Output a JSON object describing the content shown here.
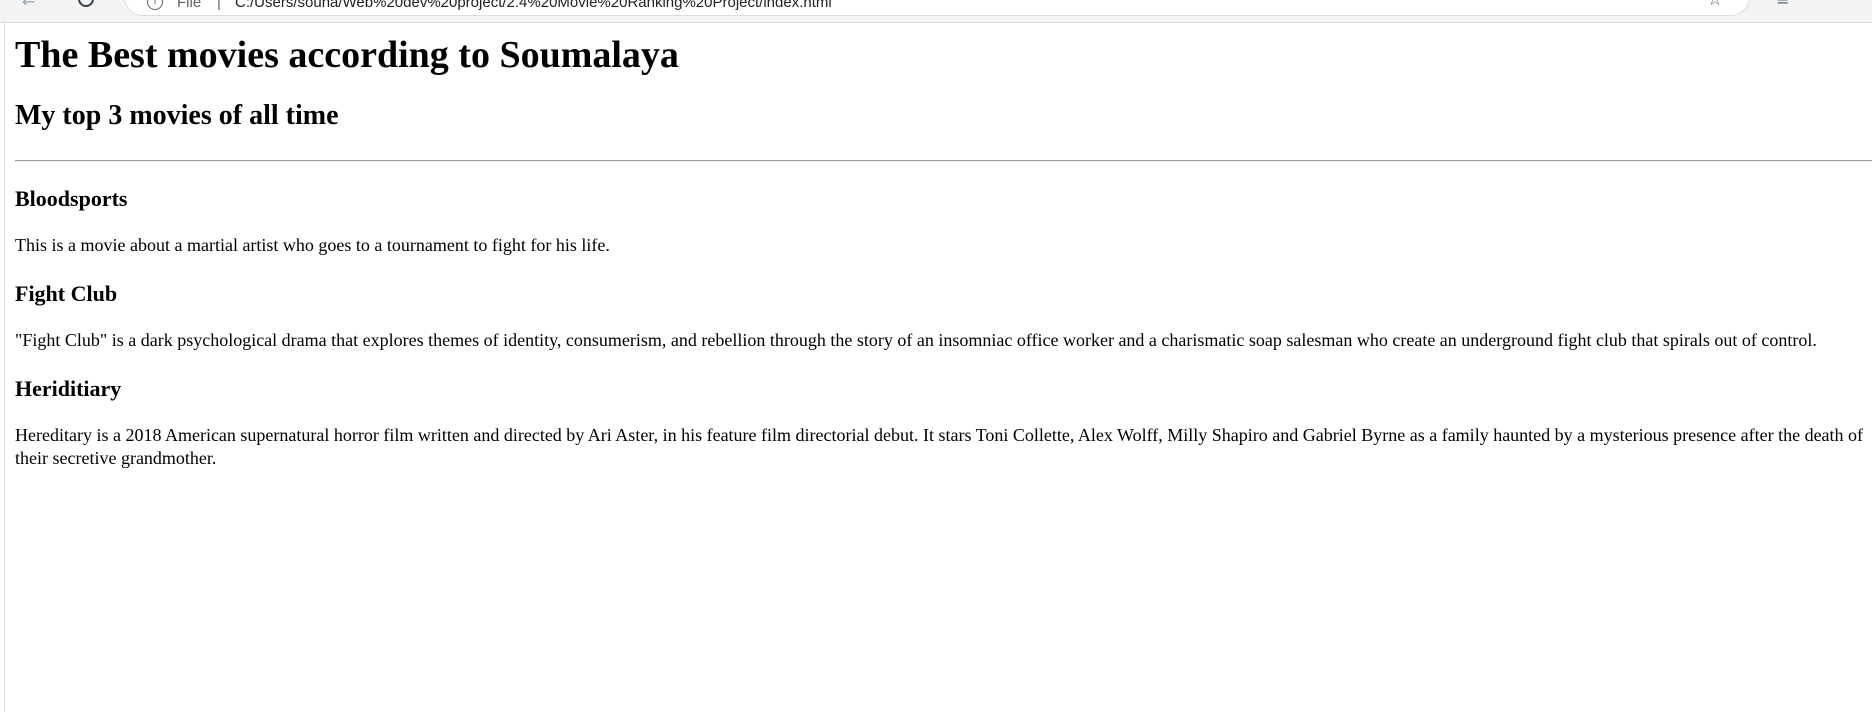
{
  "browser": {
    "scheme_label": "File",
    "url": "C:/Users/souna/Web%20dev%20project/2.4%20Movie%20Ranking%20Project/index.html"
  },
  "page": {
    "title": "The Best movies according to Soumalaya",
    "subtitle": "My top 3 movies of all time",
    "movies": [
      {
        "title": "Bloodsports",
        "description": "This is a movie about a martial artist who goes to a tournament to fight for his life."
      },
      {
        "title": "Fight Club",
        "description": "\"Fight Club\" is a dark psychological drama that explores themes of identity, consumerism, and rebellion through the story of an insomniac office worker and a charismatic soap salesman who create an underground fight club that spirals out of control."
      },
      {
        "title": "Heriditiary",
        "description": "Hereditary is a 2018 American supernatural horror film written and directed by Ari Aster, in his feature film directorial debut. It stars Toni Collette, Alex Wolff, Milly Shapiro and Gabriel Byrne as a family haunted by a mysterious presence after the death of their secretive grandmother."
      }
    ]
  }
}
